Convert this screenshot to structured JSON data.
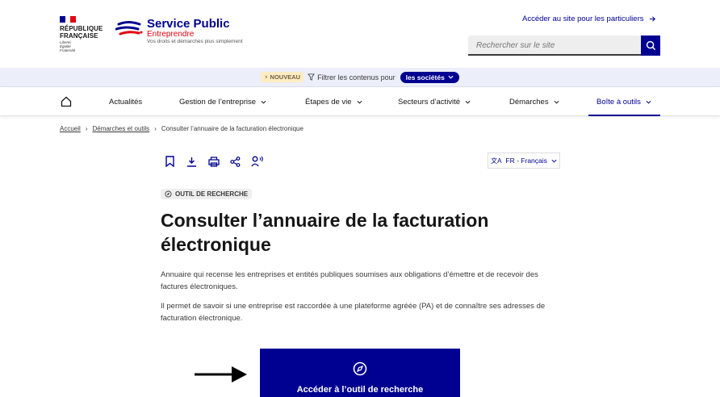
{
  "header": {
    "republic_line1": "RÉPUBLIQUE",
    "republic_line2": "FRANÇAISE",
    "devise": [
      "Liberté",
      "Égalité",
      "Fraternité"
    ],
    "brand_title": "Service Public",
    "brand_subtitle": "Entreprendre",
    "brand_tagline": "Vos droits et démarches plus simplement",
    "top_link": "Accéder au site pour les particuliers",
    "search_placeholder": "Rechercher sur le site"
  },
  "filter_bar": {
    "badge": "NOUVEAU",
    "text": "Filtrer les contenus pour",
    "pill": "les sociétés"
  },
  "nav": {
    "items": [
      {
        "label": "Actualités"
      },
      {
        "label": "Gestion de l’entreprise"
      },
      {
        "label": "Étapes de vie"
      },
      {
        "label": "Secteurs d’activité"
      },
      {
        "label": "Démarches"
      },
      {
        "label": "Boîte à outils"
      }
    ]
  },
  "breadcrumb": [
    "Accueil",
    "Démarches et outils",
    "Consulter l’annuaire de la facturation électronique"
  ],
  "language": "FR - Français",
  "tag": "OUTIL DE RECHERCHE",
  "title": "Consulter l’annuaire de la facturation électronique",
  "paragraphs": [
    "Annuaire qui recense les entreprises et entités publiques soumises aux obligations d’émettre et de recevoir des factures électroniques.",
    "Il permet de savoir si une entreprise est raccordée à une plateforme agréée (PA) et de connaître ses adresses de facturation électronique."
  ],
  "cta": "Accéder à l’outil de recherche",
  "colors": {
    "primary": "#000091",
    "red": "#e1000f",
    "filter_bg": "#eceefa"
  }
}
